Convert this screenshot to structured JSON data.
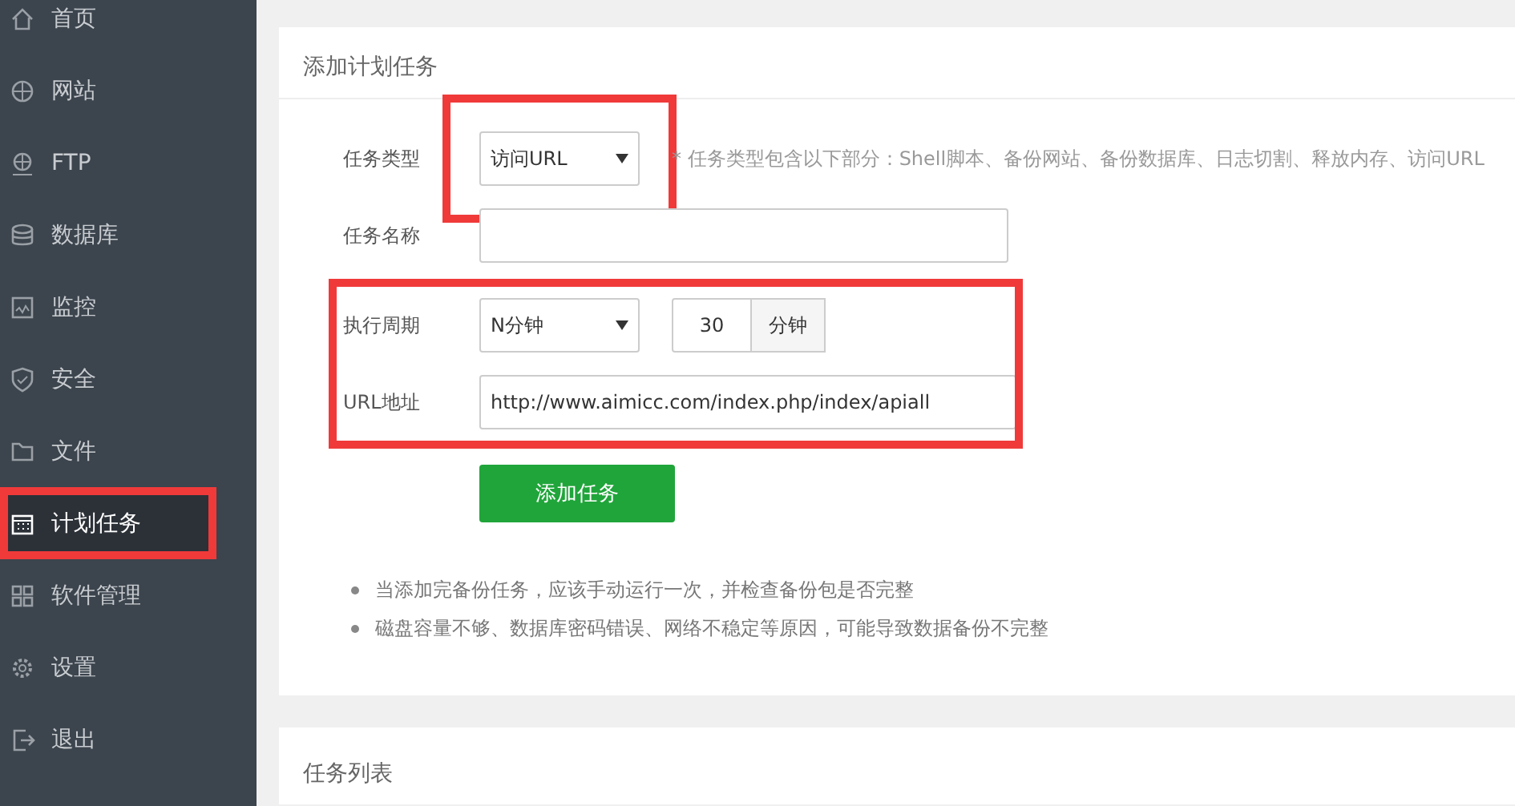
{
  "sidebar": {
    "items": [
      {
        "label": "首页",
        "selected": false,
        "highlighted": false
      },
      {
        "label": "网站",
        "selected": false,
        "highlighted": false
      },
      {
        "label": "FTP",
        "selected": false,
        "highlighted": false
      },
      {
        "label": "数据库",
        "selected": false,
        "highlighted": false
      },
      {
        "label": "监控",
        "selected": false,
        "highlighted": false
      },
      {
        "label": "安全",
        "selected": false,
        "highlighted": false
      },
      {
        "label": "文件",
        "selected": false,
        "highlighted": false
      },
      {
        "label": "计划任务",
        "selected": true,
        "highlighted": true
      },
      {
        "label": "软件管理",
        "selected": false,
        "highlighted": false
      },
      {
        "label": "设置",
        "selected": false,
        "highlighted": false
      },
      {
        "label": "退出",
        "selected": false,
        "highlighted": false
      }
    ]
  },
  "add_task": {
    "title": "添加计划任务",
    "rows": [
      {
        "kind": "select",
        "label": "任务类型",
        "value": "访问URL",
        "hint": "* 任务类型包含以下部分：Shell脚本、备份网站、备份数据库、日志切割、释放内存、访问URL",
        "highlighted": true
      },
      {
        "kind": "text",
        "label": "任务名称",
        "value": ""
      },
      {
        "kind": "group",
        "highlighted": true,
        "rows": [
          {
            "kind": "cycle",
            "label": "执行周期",
            "value": "N分钟",
            "amount": "30",
            "unit": "分钟"
          },
          {
            "kind": "url",
            "label": "URL地址",
            "value": "http://www.aimicc.com/index.php/index/apiall"
          }
        ]
      }
    ],
    "submit": "添加任务",
    "notes": [
      "当添加完备份任务，应该手动运行一次，并检查备份包是否完整",
      "磁盘容量不够、数据库密码错误、网络不稳定等原因，可能导致数据备份不完整"
    ]
  },
  "task_list": {
    "title": "任务列表"
  }
}
